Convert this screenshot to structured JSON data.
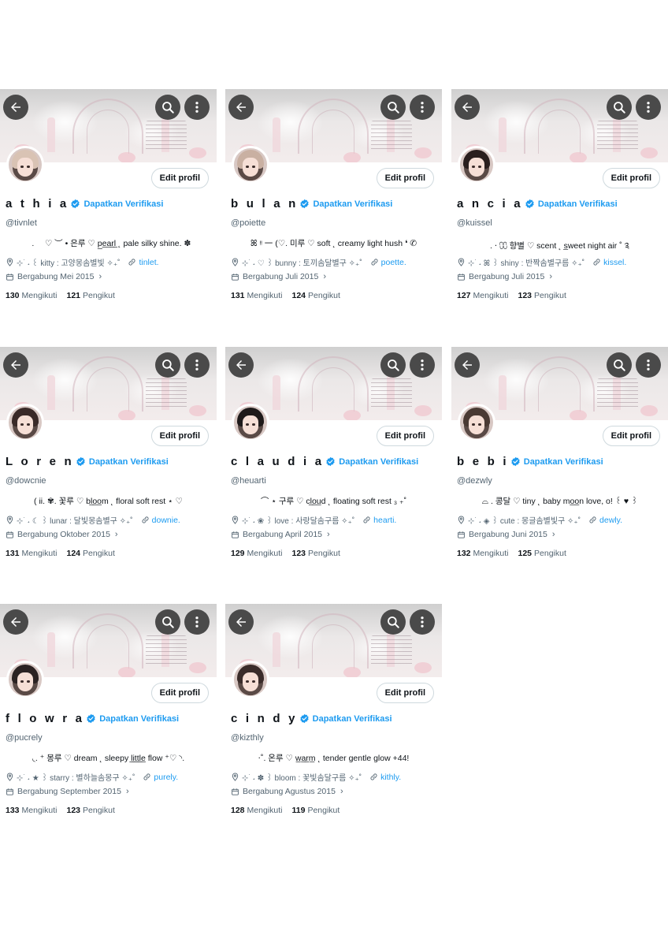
{
  "common": {
    "edit_label": "Edit profil",
    "verify_label": "Dapatkan Verifikasi",
    "following_label": "Mengikuti",
    "followers_label": "Pengikut",
    "icons": {
      "back": "arrow-left-icon",
      "search": "search-icon",
      "more": "more-vertical-icon",
      "verified": "verified-badge-icon",
      "location": "location-pin-icon",
      "link": "link-icon",
      "calendar": "calendar-icon"
    },
    "colors": {
      "accent": "#1d9bf0",
      "text": "#0f1419",
      "muted": "#536471",
      "button_bg": "#4a4a4a"
    }
  },
  "profiles": [
    {
      "name": "a t h i a",
      "handle": "@tivnlet",
      "bio": "⠀. ⠀ ♡ ︶ • 은루 ♡ p̲e̲a̲r̲l̲ ˛ pale silky shine. ✽",
      "location": "⊹ ࣪ ˖ ꒰ kitty : 고양몽솜별빛 ✧₊˚",
      "website": "tinlet.",
      "joined": "Bergabung Mei 2015",
      "following": "130",
      "followers": "121"
    },
    {
      "name": "b u l a n",
      "handle": "@poiette",
      "bio": "ꕤ ᵎᵎ 一 (♡. 미루 ♡ soft ˛ creamy light hush ❛ ✆",
      "location": "⊹ ࣪ ˖ ♡ ꒱ bunny : 토끼솜달별구 ✧₊˚",
      "website": "poette.",
      "joined": "Bergabung Juli 2015",
      "following": "131",
      "followers": "124"
    },
    {
      "name": "a n c i a",
      "handle": "@kuissel",
      "bio": ". ⋅ ⩇⩇ 향별 ♡ scent ˛ s̲weet night air ˚ ༉",
      "location": "⊹ ࣪ ˖ ꕤ ꒱ shiny : 반짝솜별구름 ✧₊˚",
      "website": "kissel.",
      "joined": "Bergabung Juli 2015",
      "following": "127",
      "followers": "123"
    },
    {
      "name": "L o r e n",
      "handle": "@dowcnie",
      "bio": "( ii. ✾. 꽃루 ♡ bl̲o̲o̲m ˛ floral soft rest ⋆ ♡",
      "location": "⊹ ࣪ ˖ ☾ ꒱ lunar : 달빛몽솜별구 ✧₊˚",
      "website": "downie.",
      "joined": "Bergabung Oktober 2015",
      "following": "131",
      "followers": "124"
    },
    {
      "name": "c l a u d i a",
      "handle": "@heuarti",
      "bio": "⌒ ⋆ 구루 ♡ cl̲o̲u̲d ˛ floating soft rest ₃ ₊˚",
      "location": "⊹ ࣪ ˖ ❀ ꒱ love : 사랑달솜구름 ✧₊˚",
      "website": "hearti.",
      "joined": "Bergabung April 2015",
      "following": "129",
      "followers": "123"
    },
    {
      "name": "b e b i",
      "handle": "@dezwly",
      "bio": "⌓ . 콩달 ♡ tiny ˛ baby mo̲o̲n love, o! ꒰ ♥ ꒱",
      "location": "⊹ ࣪ ˖ ◈ ꒱ cute : 몽글솜별빛구 ✧₊˚",
      "website": "dewly.",
      "joined": "Bergabung Juni 2015",
      "following": "132",
      "followers": "125"
    },
    {
      "name": "f l o w r a",
      "handle": "@pucrely",
      "bio": "◟. ⁺ 몽루 ♡ dream ˛ sleepy l̲i̲t̲t̲l̲e̲ flow ⁺♡ ◝.",
      "location": "⊹ ࣪ ˖ ★ ꒱ starry : 별하늘솜몽구 ✧₊˚",
      "website": "purely.",
      "joined": "Bergabung September 2015",
      "following": "133",
      "followers": "123"
    },
    {
      "name": "c i n d y",
      "handle": "@kizthly",
      "bio": "⋅˚. 온루 ♡ w̲a̲r̲m̲ ˛ tender gentle glow +44!",
      "location": "⊹ ࣪ ˖ ✽ ꒱ bloom : 꽃빛솜달구름 ✧₊˚",
      "website": "kithly.",
      "joined": "Bergabung Agustus 2015",
      "following": "128",
      "followers": "119"
    }
  ]
}
